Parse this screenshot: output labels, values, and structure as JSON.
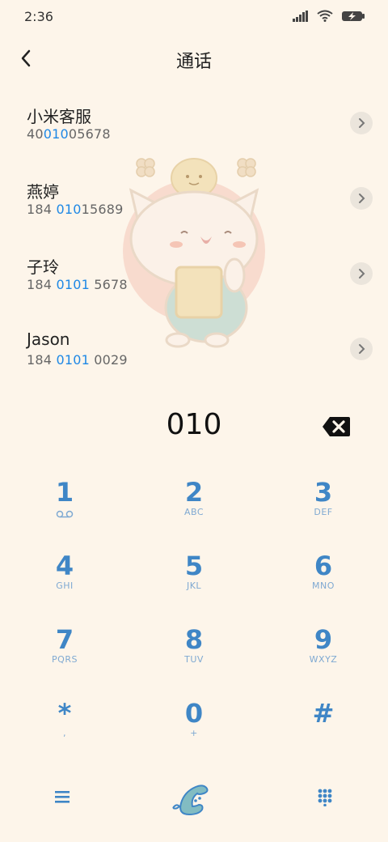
{
  "status": {
    "time": "2:36"
  },
  "header": {
    "title": "通话"
  },
  "contacts": [
    {
      "name": "小米客服",
      "num_pre": "40",
      "num_hl": "010",
      "num_post": "05678"
    },
    {
      "name": "燕婷",
      "num_pre": "184 ",
      "num_hl": "010",
      "num_post": "15689"
    },
    {
      "name": "子玲",
      "num_pre": "184 ",
      "num_hl": "0101",
      "num_post": " 5678"
    },
    {
      "name": "Jason",
      "num_pre": "184 ",
      "num_hl": "0101",
      "num_post": " 0029"
    }
  ],
  "dialer": {
    "digits": "010"
  },
  "keypad": [
    {
      "digit": "1",
      "letters": ""
    },
    {
      "digit": "2",
      "letters": "ABC"
    },
    {
      "digit": "3",
      "letters": "DEF"
    },
    {
      "digit": "4",
      "letters": "GHI"
    },
    {
      "digit": "5",
      "letters": "JKL"
    },
    {
      "digit": "6",
      "letters": "MNO"
    },
    {
      "digit": "7",
      "letters": "PQRS"
    },
    {
      "digit": "8",
      "letters": "TUV"
    },
    {
      "digit": "9",
      "letters": "WXYZ"
    },
    {
      "digit": "*",
      "letters": ","
    },
    {
      "digit": "0",
      "letters": "+"
    },
    {
      "digit": "#",
      "letters": ""
    }
  ],
  "colors": {
    "accent": "#3f86c6",
    "highlight": "#1e88e5",
    "background": "#fdf5ea"
  },
  "icons": {
    "back": "chevron-left-icon",
    "voicemail": "voicemail-icon",
    "backspace": "backspace-icon",
    "menu": "menu-icon",
    "call": "phone-icon",
    "keypad": "dialpad-icon"
  }
}
